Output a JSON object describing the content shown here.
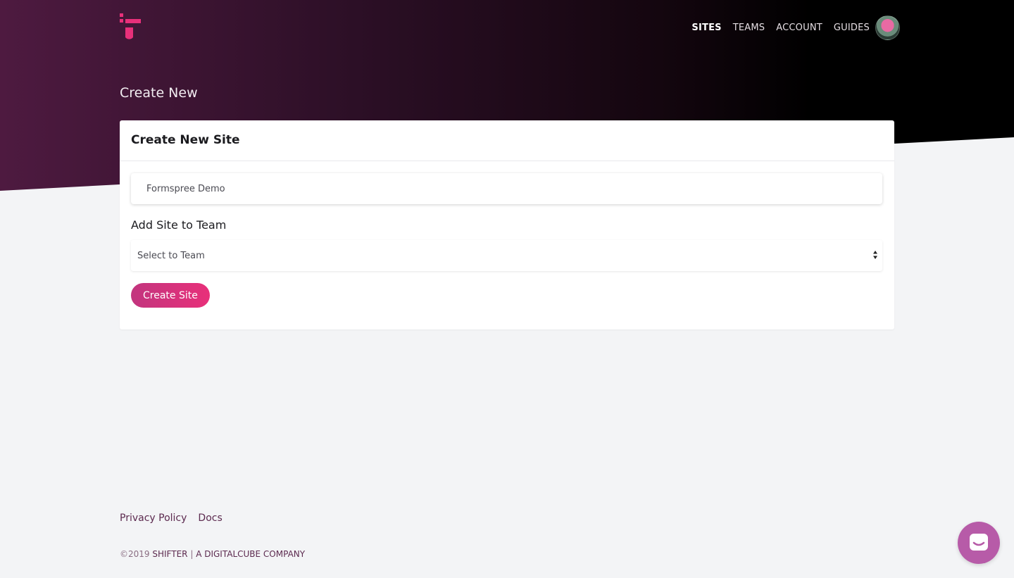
{
  "nav": {
    "items": [
      {
        "label": "SITES",
        "active": true
      },
      {
        "label": "TEAMS",
        "active": false
      },
      {
        "label": "ACCOUNT",
        "active": false
      },
      {
        "label": "GUIDES",
        "active": false
      }
    ]
  },
  "page": {
    "title": "Create New"
  },
  "card": {
    "title": "Create New Site",
    "site_name_value": "Formspree Demo",
    "team_label": "Add Site to Team",
    "team_select_value": "Select to Team",
    "create_label": "Create Site"
  },
  "footer": {
    "links": [
      "Privacy Policy",
      "Docs"
    ],
    "copyright_year": "©2019",
    "brand": "SHIFTER",
    "separator": "|",
    "company": "A DIGITALCUBE COMPANY"
  },
  "colors": {
    "accent": "#e8307a",
    "chat": "#b75ba8",
    "hero_dark": "#000000",
    "hero_purple": "#4e1a40"
  },
  "icons": {
    "logo": "shifter-logo-icon",
    "select": "sort-arrows-icon",
    "chat": "chat-icon"
  }
}
